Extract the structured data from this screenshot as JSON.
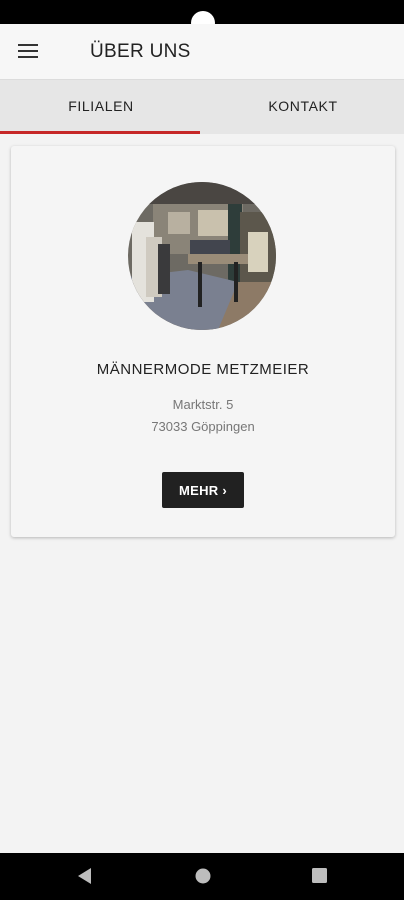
{
  "header": {
    "title": "ÜBER UNS",
    "menu_icon": "hamburger-menu-icon"
  },
  "tabs": [
    {
      "label": "FILIALEN",
      "active": true
    },
    {
      "label": "KONTAKT",
      "active": false
    }
  ],
  "colors": {
    "accent": "#c62828",
    "button_bg": "#212121"
  },
  "store": {
    "name": "MÄNNERMODE METZMEIER",
    "street": "Marktstr. 5",
    "city": "73033 Göppingen",
    "more_label": "MEHR ›"
  },
  "nav": {
    "back_icon": "back-triangle-icon",
    "home_icon": "home-circle-icon",
    "recents_icon": "recents-square-icon"
  }
}
